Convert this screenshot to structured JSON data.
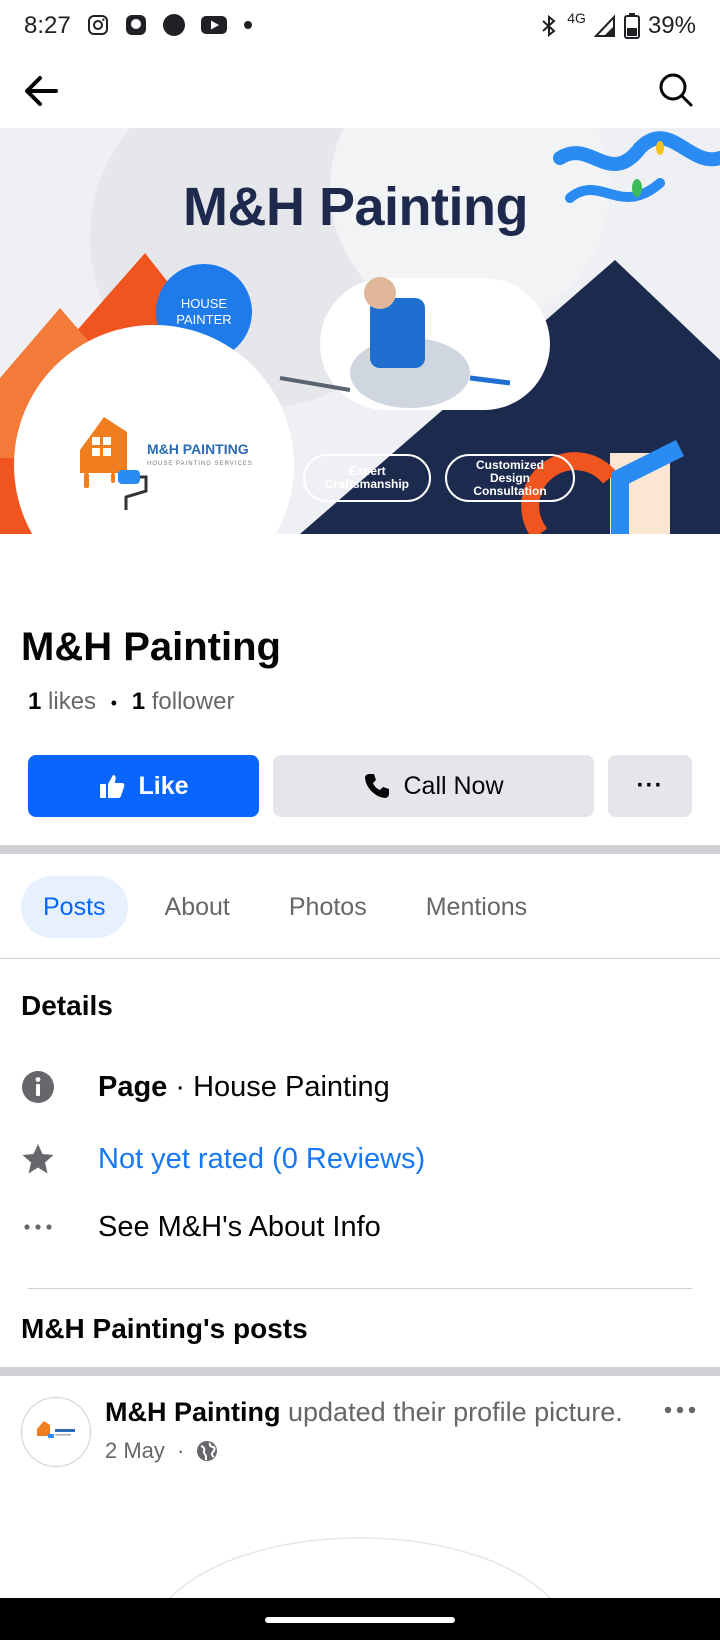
{
  "status_bar": {
    "time": "8:27",
    "network": "4G",
    "battery": "39%",
    "icons": [
      "instagram-icon",
      "app-icon",
      "circle-icon",
      "youtube-icon",
      "dot-icon",
      "bluetooth-icon",
      "signal-icon",
      "battery-icon"
    ]
  },
  "app_bar": {
    "back_icon": "back-arrow-icon",
    "search_icon": "search-icon"
  },
  "cover": {
    "title": "M&H Painting",
    "badge": "HOUSE PAINTER",
    "pill_1": "Expert Craftsmanship",
    "pill_2": "Customized Design Consultation"
  },
  "logo": {
    "name": "M&H PAINTING",
    "tagline": "HOUSE PAINTING SERVICES"
  },
  "page": {
    "name": "M&H Painting",
    "likes_count": "1",
    "likes_label": "likes",
    "separator": "•",
    "followers_count": "1",
    "followers_label": "follower"
  },
  "actions": {
    "like_label": "Like",
    "call_label": "Call Now",
    "more_label": "···"
  },
  "tabs": [
    {
      "label": "Posts",
      "active": true
    },
    {
      "label": "About",
      "active": false
    },
    {
      "label": "Photos",
      "active": false
    },
    {
      "label": "Mentions",
      "active": false
    }
  ],
  "details": {
    "title": "Details",
    "page_type_label": "Page",
    "page_type_sep": " · ",
    "page_type_value": "House Painting",
    "rating": "Not yet rated (0 Reviews)",
    "about_link": "See M&H's About Info"
  },
  "posts": {
    "title": "M&H Painting's posts",
    "items": [
      {
        "author": "M&H Painting",
        "action": " updated their profile picture.",
        "date": "2 May",
        "meta_sep": " · ",
        "privacy_icon": "globe-icon"
      }
    ]
  },
  "colors": {
    "accent": "#0866ff",
    "link": "#1877f2",
    "muted": "#65676b",
    "divider": "#ced0d4"
  }
}
